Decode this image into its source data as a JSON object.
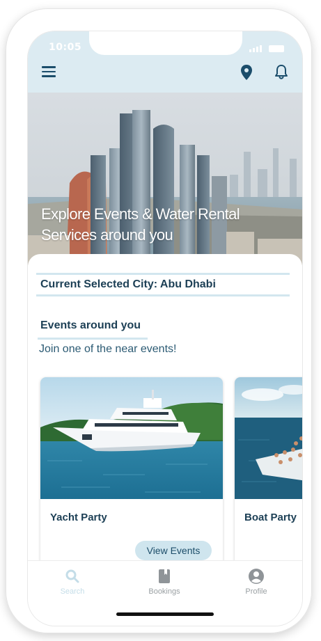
{
  "status_bar": {
    "time": "10:05"
  },
  "header": {
    "menu_icon": "hamburger-menu-icon",
    "location_icon": "location-pin-icon",
    "notification_icon": "bell-icon"
  },
  "hero": {
    "title": "Explore Events & Water Rental Services around you"
  },
  "city": {
    "label": "Current Selected City: Abu Dhabi"
  },
  "events": {
    "title": "Events around you",
    "subtitle": "Join one of the near events!",
    "cards": [
      {
        "title": "Yacht Party",
        "button": "View Events"
      },
      {
        "title": "Boat Party"
      }
    ]
  },
  "bottom_nav": {
    "items": [
      {
        "label": "Search",
        "icon": "search-icon",
        "active": true
      },
      {
        "label": "Bookings",
        "icon": "book-icon",
        "active": false
      },
      {
        "label": "Profile",
        "icon": "profile-icon",
        "active": false
      }
    ]
  },
  "colors": {
    "primary_dark": "#1c3f55",
    "accent_light": "#d2e6ef",
    "header_bg": "#dcebf2",
    "nav_inactive": "#9aa0a3"
  }
}
